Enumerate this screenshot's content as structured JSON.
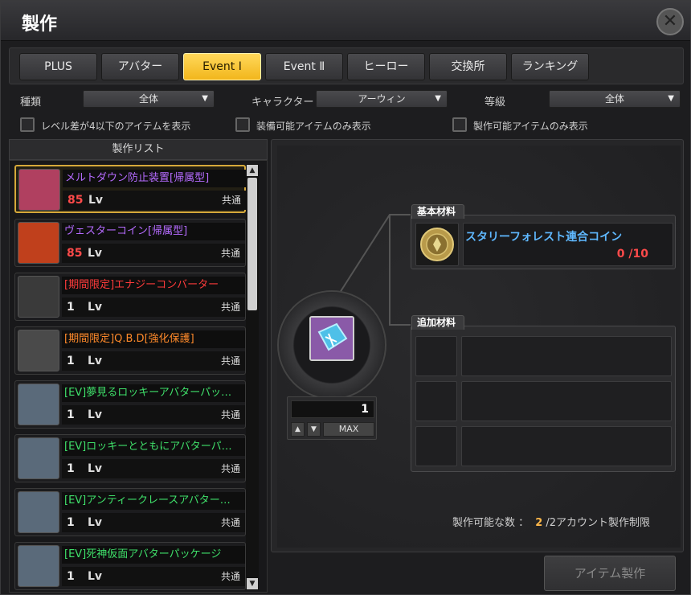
{
  "window": {
    "title": "製作"
  },
  "tabs": [
    {
      "label": "PLUS"
    },
    {
      "label": "アバター"
    },
    {
      "label": "Event Ⅰ"
    },
    {
      "label": "Event Ⅱ"
    },
    {
      "label": "ヒーロー"
    },
    {
      "label": "交換所"
    },
    {
      "label": "ランキング"
    }
  ],
  "active_tab": "Event Ⅰ",
  "filters": {
    "type_label": "種類",
    "type_value": "全体",
    "character_label": "キャラクター",
    "character_value": "アーウィン",
    "grade_label": "等級",
    "grade_value": "全体",
    "cb_level": "レベル差が4以下のアイテムを表示",
    "cb_equip": "装備可能アイテムのみ表示",
    "cb_craftable": "製作可能アイテムのみ表示"
  },
  "list": {
    "header": "製作リスト",
    "items": [
      {
        "name": "メルトダウン防止装置[帰属型]",
        "level": "85",
        "lv": "Lv",
        "shared": "共通",
        "name_color": "#b56bff",
        "level_color": "#ff4a4a",
        "icon": "meltdown-device-icon",
        "icon_color": "#b04060"
      },
      {
        "name": "ヴェスターコイン[帰属型]",
        "level": "85",
        "lv": "Lv",
        "shared": "共通",
        "name_color": "#b56bff",
        "level_color": "#ff4a4a",
        "icon": "vester-coin-icon",
        "icon_color": "#c0401c"
      },
      {
        "name": "[期間限定]エナジーコンバーター",
        "level": "1",
        "lv": "Lv",
        "shared": "共通",
        "name_color": "#ff3b3b",
        "level_color": "#e8e8e8",
        "icon": "energy-converter-icon",
        "icon_color": "#3a3a3a"
      },
      {
        "name": "[期間限定]Q.B.D[強化保護]",
        "level": "1",
        "lv": "Lv",
        "shared": "共通",
        "name_color": "#ff8a2a",
        "level_color": "#e8e8e8",
        "icon": "qbd-card-icon",
        "icon_color": "#4a4a4a"
      },
      {
        "name": "[EV]夢見るロッキーアバターパッ…",
        "level": "1",
        "lv": "Lv",
        "shared": "共通",
        "name_color": "#3fe06a",
        "level_color": "#e8e8e8",
        "icon": "avatar-package-icon",
        "icon_color": "#5a6a7a"
      },
      {
        "name": "[EV]ロッキーとともにアバターパ…",
        "level": "1",
        "lv": "Lv",
        "shared": "共通",
        "name_color": "#3fe06a",
        "level_color": "#e8e8e8",
        "icon": "avatar-package-icon",
        "icon_color": "#5a6a7a"
      },
      {
        "name": "[EV]アンティークレースアバター…",
        "level": "1",
        "lv": "Lv",
        "shared": "共通",
        "name_color": "#3fe06a",
        "level_color": "#e8e8e8",
        "icon": "avatar-package-icon",
        "icon_color": "#5a6a7a"
      },
      {
        "name": "[EV]死神仮面アバターパッケージ",
        "level": "1",
        "lv": "Lv",
        "shared": "共通",
        "name_color": "#3fe06a",
        "level_color": "#e8e8e8",
        "icon": "avatar-package-icon",
        "icon_color": "#5a6a7a"
      }
    ]
  },
  "detail": {
    "base_material_label": "基本材料",
    "material_name": "スタリーフォレスト連合コイン",
    "material_count": "0 /10",
    "extra_material_label": "追加材料",
    "quantity": "1",
    "max_label": "MAX",
    "craftable_label": "製作可能な数 ：",
    "craftable_value": "2",
    "craftable_suffix": "/2アカウント製作制限",
    "craft_button": "アイテム製作"
  }
}
